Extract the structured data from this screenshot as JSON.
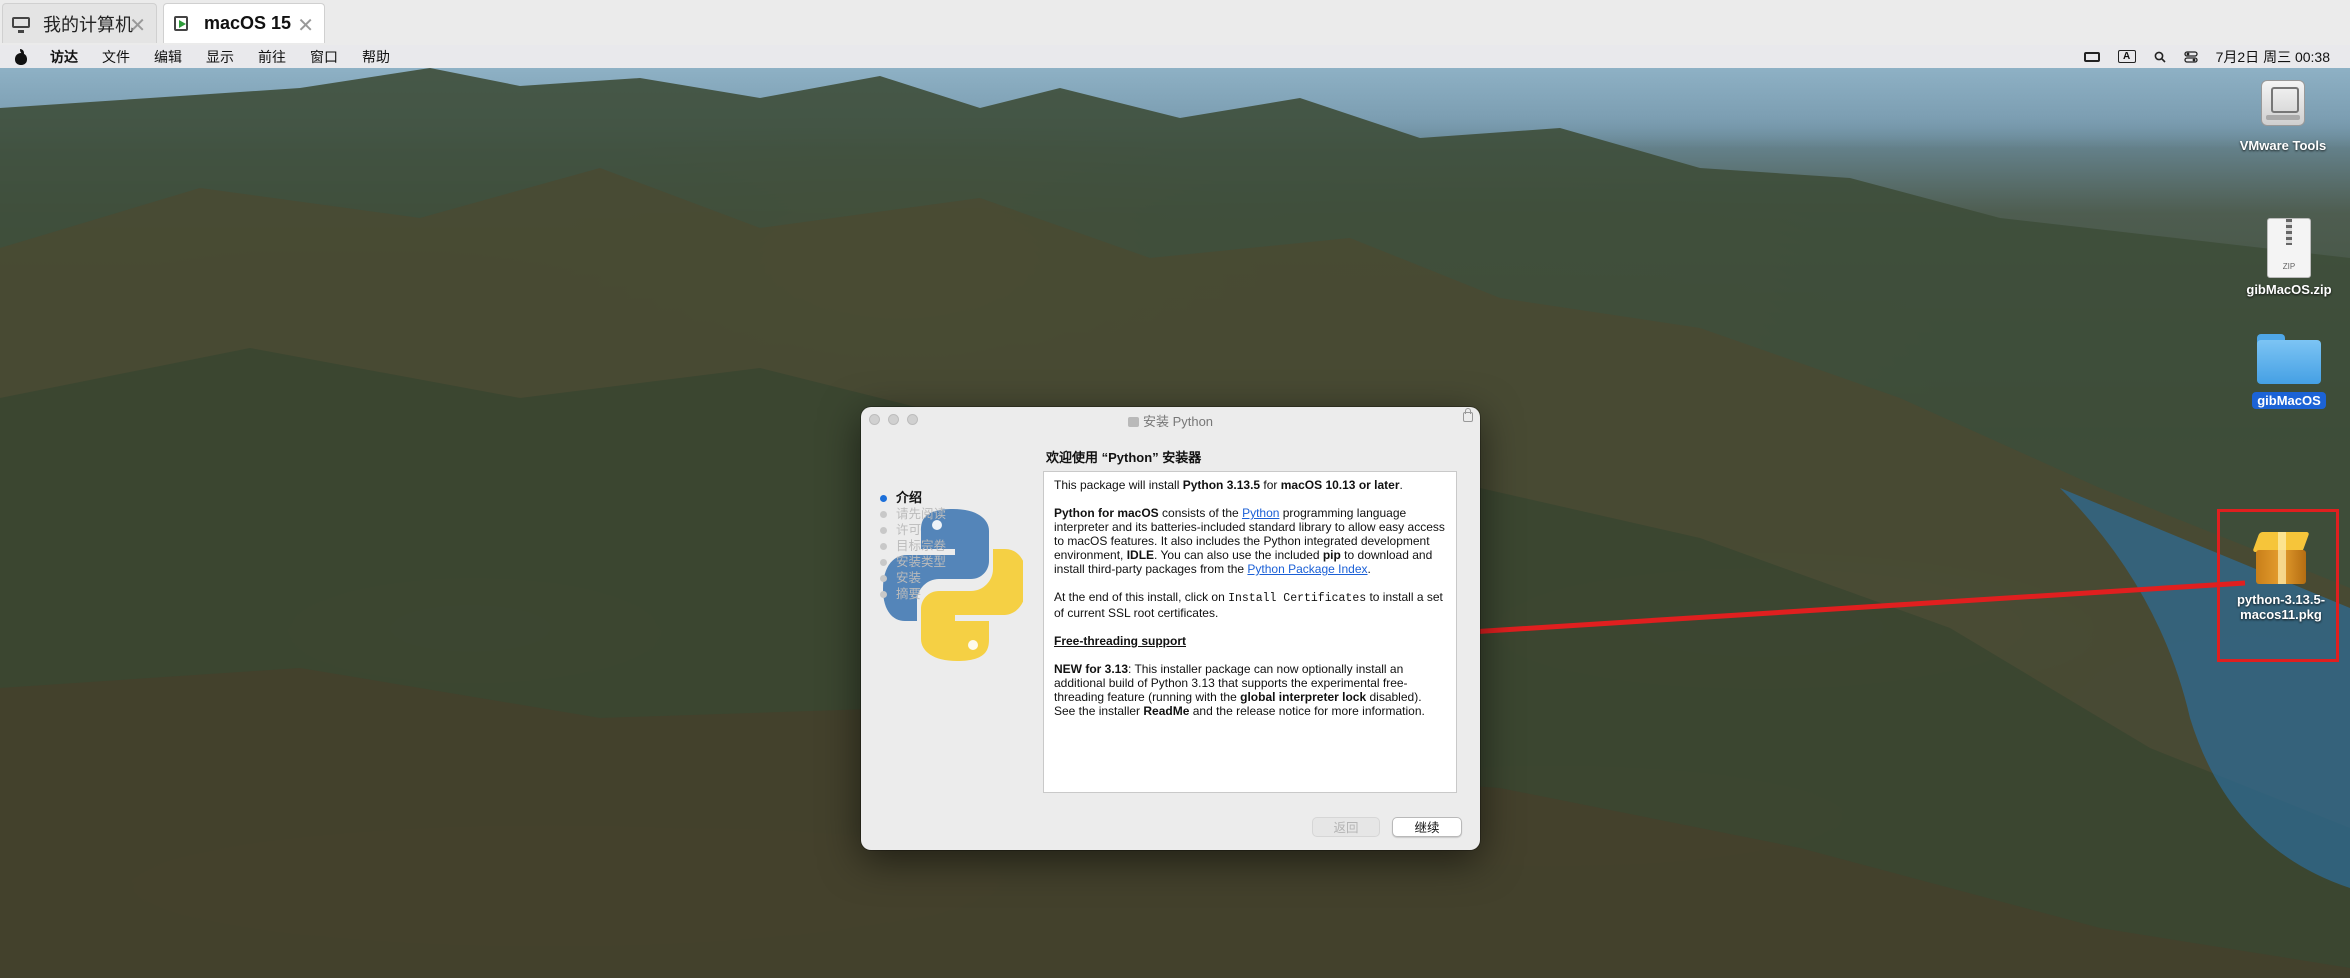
{
  "vmware_tabs": [
    {
      "label": "我的计算机",
      "icon": "monitor-icon",
      "active": false
    },
    {
      "label": "macOS 15",
      "icon": "vm-icon",
      "active": true
    }
  ],
  "tab_close": "✕",
  "menubar": {
    "items": [
      "访达",
      "文件",
      "编辑",
      "显示",
      "前往",
      "窗口",
      "帮助"
    ],
    "input_method": "A",
    "clock": "7月2日 周三  00:38"
  },
  "desktop_icons": {
    "vmware_tools": "VMware Tools",
    "zip": "gibMacOS.zip",
    "zip_badge": "ZIP",
    "folder": "gibMacOS",
    "pkg_line1": "python-3.13.5-",
    "pkg_line2": "macos11.pkg"
  },
  "colors": {
    "annotation": "#e01f1f",
    "accent": "#1c6fd9",
    "link": "#1a5fd6"
  },
  "installer": {
    "title": "安装 Python",
    "heading": "欢迎使用 “Python” 安装器",
    "steps": [
      "介绍",
      "请先阅读",
      "许可",
      "目标宗卷",
      "安装类型",
      "安装",
      "摘要"
    ],
    "active_step": 0,
    "content": {
      "p1_a": "This package will install ",
      "p1_b": "Python 3.13.5",
      "p1_c": " for ",
      "p1_d": "macOS 10.13 or later",
      "p1_e": ".",
      "p2_a": "Python for macOS",
      "p2_b": " consists of the ",
      "p2_link1": "Python",
      "p2_c": " programming language interpreter and its batteries-included standard library to allow easy access to macOS features.  It also includes the Python integrated development environment, ",
      "p2_d": "IDLE",
      "p2_e": ".  You can also use the included ",
      "p2_f": "pip",
      "p2_g": " to download and install third-party packages from the ",
      "p2_link2": "Python Package Index",
      "p2_h": ".",
      "p3_a": "At the end of this install, click on ",
      "p3_code": "Install Certificates",
      "p3_b": " to install a set of current SSL root certificates.",
      "p4_heading": "Free-threading support",
      "p5_a": "NEW for 3.13",
      "p5_b": ":  This installer package can now optionally install an additional build of Python 3.13 that supports the experimental free-threading feature (running with the ",
      "p5_c": "global interpreter lock",
      "p5_d": " disabled).  See the installer ",
      "p5_e": "ReadMe",
      "p5_f": " and the release notice for more information."
    },
    "back_label": "返回",
    "continue_label": "继续"
  }
}
